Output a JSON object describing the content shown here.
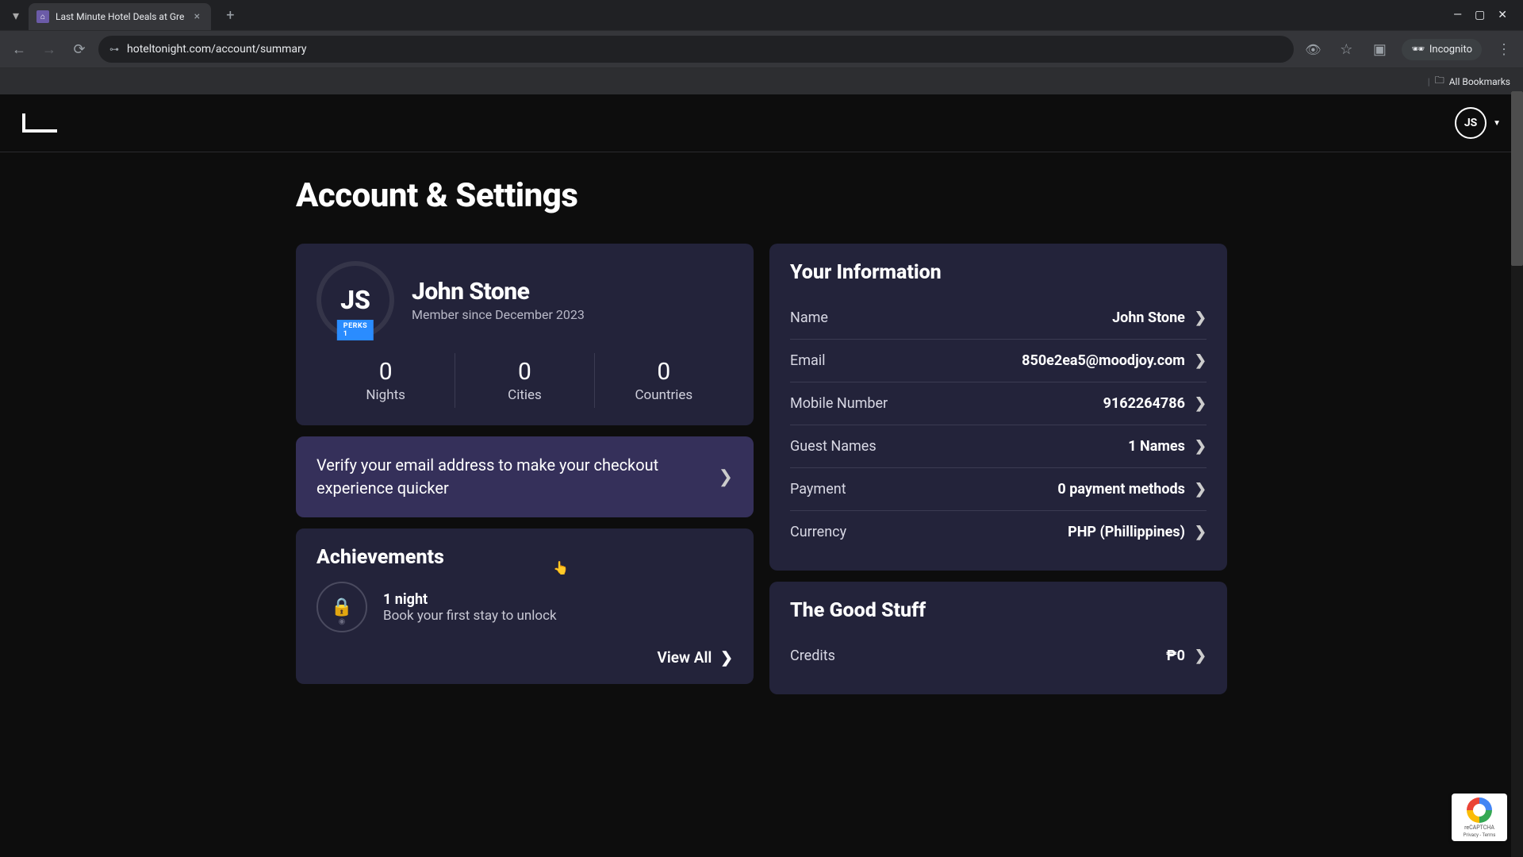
{
  "browser": {
    "tab_title": "Last Minute Hotel Deals at Gre",
    "url": "hoteltonight.com/account/summary",
    "incognito": "Incognito",
    "bookmarks": "All Bookmarks"
  },
  "header": {
    "avatar_initials": "JS"
  },
  "page": {
    "title": "Account & Settings"
  },
  "profile": {
    "avatar_initials": "JS",
    "perks_badge": "PERKS 1",
    "name": "John Stone",
    "member_since": "Member since December 2023",
    "stats": {
      "nights": {
        "value": "0",
        "label": "Nights"
      },
      "cities": {
        "value": "0",
        "label": "Cities"
      },
      "countries": {
        "value": "0",
        "label": "Countries"
      }
    }
  },
  "verify": {
    "text": "Verify your email address to make your checkout experience quicker"
  },
  "achievements": {
    "title": "Achievements",
    "item": {
      "title": "1 night",
      "subtitle": "Book your first stay to unlock"
    },
    "view_all": "View All"
  },
  "info": {
    "title": "Your Information",
    "rows": {
      "name": {
        "label": "Name",
        "value": "John Stone"
      },
      "email": {
        "label": "Email",
        "value": "850e2ea5@moodjoy.com"
      },
      "mobile": {
        "label": "Mobile Number",
        "value": "9162264786"
      },
      "guests": {
        "label": "Guest Names",
        "value": "1 Names"
      },
      "payment": {
        "label": "Payment",
        "value": "0 payment methods"
      },
      "currency": {
        "label": "Currency",
        "value": "PHP (Phillippines)"
      }
    }
  },
  "good_stuff": {
    "title": "The Good Stuff",
    "credits": {
      "label": "Credits",
      "value": "₱0"
    }
  },
  "recaptcha": {
    "text": "reCAPTCHA",
    "sub": "Privacy - Terms"
  }
}
